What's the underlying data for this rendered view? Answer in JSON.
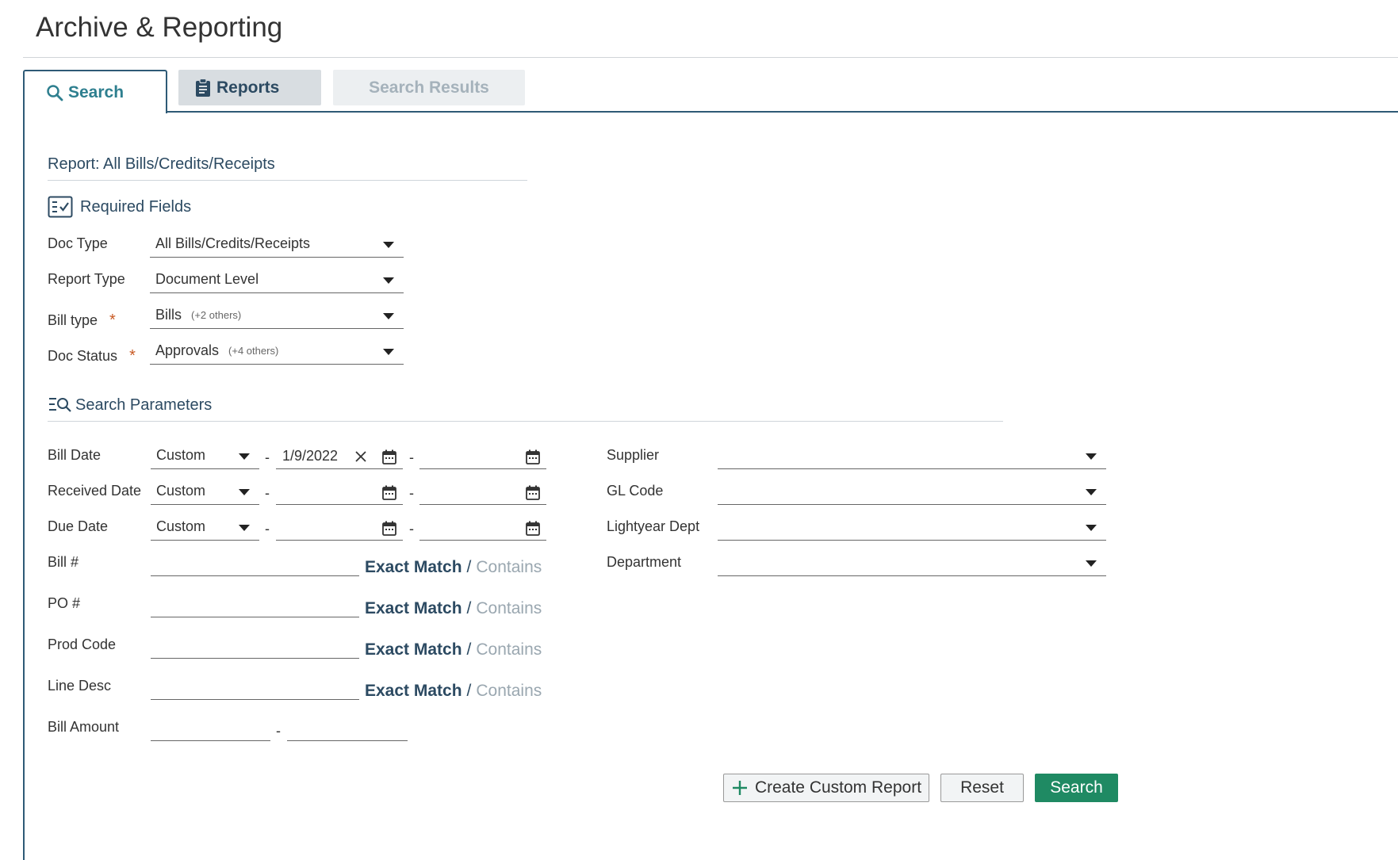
{
  "page": {
    "title": "Archive & Reporting"
  },
  "tabs": [
    {
      "label": "Search",
      "icon": "search-icon",
      "state": "active"
    },
    {
      "label": "Reports",
      "icon": "clipboard-icon",
      "state": "inactive"
    },
    {
      "label": "Search Results",
      "icon": "",
      "state": "disabled"
    }
  ],
  "report": {
    "title": "Report: All Bills/Credits/Receipts"
  },
  "required": {
    "heading": "Required Fields",
    "fields": [
      {
        "label": "Doc Type",
        "value": "All Bills/Credits/Receipts",
        "more": "",
        "required": false
      },
      {
        "label": "Report Type",
        "value": "Document Level",
        "more": "",
        "required": false
      },
      {
        "label": "Bill type",
        "value": "Bills",
        "more": "(+2 others)",
        "required": true
      },
      {
        "label": "Doc Status",
        "value": "Approvals",
        "more": "(+4 others)",
        "required": true
      }
    ],
    "required_marker": "*"
  },
  "params": {
    "heading": "Search Parameters",
    "dates": [
      {
        "label": "Bill Date",
        "mode": "Custom",
        "from": "1/9/2022",
        "to": ""
      },
      {
        "label": "Received Date",
        "mode": "Custom",
        "from": "",
        "to": ""
      },
      {
        "label": "Due Date",
        "mode": "Custom",
        "from": "",
        "to": ""
      }
    ],
    "text_fields": [
      {
        "label": "Bill #",
        "value": ""
      },
      {
        "label": "PO #",
        "value": ""
      },
      {
        "label": "Prod Code",
        "value": ""
      },
      {
        "label": "Line Desc",
        "value": ""
      }
    ],
    "exact_match_label": "Exact Match",
    "separator": "/",
    "contains_label": "Contains",
    "amount": {
      "label": "Bill Amount",
      "from": "",
      "to": ""
    },
    "range_dash": "-",
    "dropdowns": [
      {
        "label": "Supplier",
        "value": ""
      },
      {
        "label": "GL Code",
        "value": ""
      },
      {
        "label": "Lightyear Dept",
        "value": ""
      },
      {
        "label": "Department",
        "value": ""
      }
    ]
  },
  "buttons": {
    "create": "Create Custom Report",
    "reset": "Reset",
    "search": "Search"
  },
  "colors": {
    "accent": "#2e5a76",
    "primary_button": "#1f8a63",
    "required_star": "#c85a24"
  }
}
